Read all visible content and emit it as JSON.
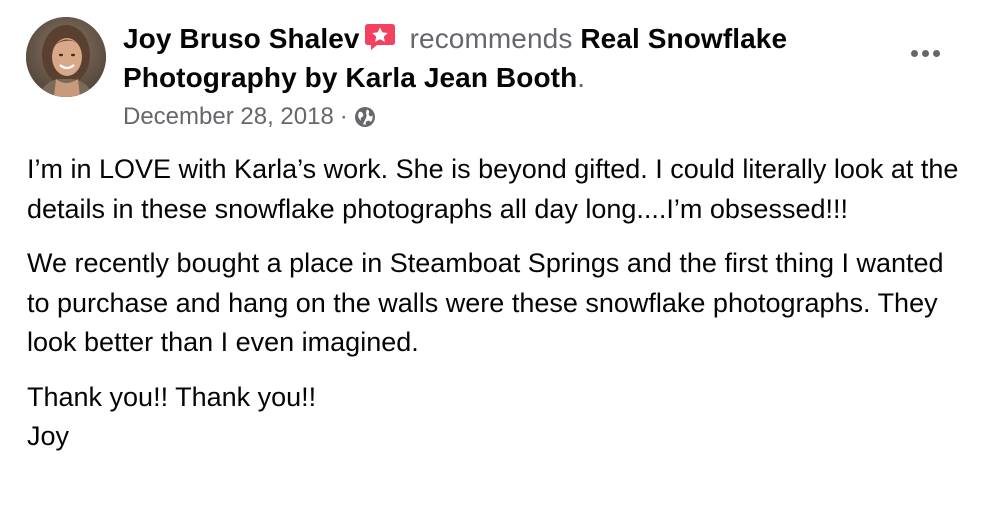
{
  "post": {
    "author_name": "Joy Bruso Shalev",
    "action_text": "recommends",
    "page_name": "Real Snowflake Photography by Karla Jean Booth",
    "period": ".",
    "date": "December 28, 2018",
    "separator": "·",
    "audience_icon": "globe-icon",
    "badge_icon": "recommend-star-icon",
    "menu_icon": "more-options-icon",
    "paragraphs": [
      "I’m in LOVE with Karla’s work. She is beyond gifted. I could literally look at the details in these snowflake photographs all day long....I’m obsessed!!!",
      "We recently bought a place in Steamboat Springs and the first thing I wanted to purchase and hang on the walls were these snowflake photographs. They look better than I even imagined.",
      "Thank you!! Thank you!!\nJoy"
    ]
  },
  "colors": {
    "primary_text": "#050505",
    "secondary_text": "#65676b",
    "badge": "#f3425f",
    "background": "#ffffff"
  }
}
